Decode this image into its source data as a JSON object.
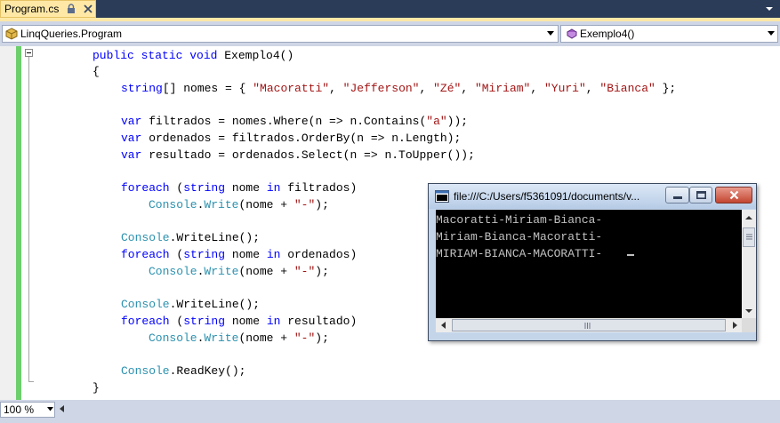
{
  "tab": {
    "title": "Program.cs",
    "pin_icon": "lock-icon",
    "close_icon": "close-icon"
  },
  "navbar": {
    "class_selector": "LinqQueries.Program",
    "member_selector": "Exemplo4()"
  },
  "code": {
    "lines": [
      [
        [
          "kw",
          "public static void "
        ],
        [
          "p",
          "Exemplo4()"
        ]
      ],
      [
        [
          "p",
          "{"
        ]
      ],
      [
        [
          "kw",
          "string"
        ],
        [
          "p",
          "[] nomes = { "
        ],
        [
          "str",
          "\"Macoratti\""
        ],
        [
          "p",
          ", "
        ],
        [
          "str",
          "\"Jefferson\""
        ],
        [
          "p",
          ", "
        ],
        [
          "str",
          "\"Zé\""
        ],
        [
          "p",
          ", "
        ],
        [
          "str",
          "\"Miriam\""
        ],
        [
          "p",
          ", "
        ],
        [
          "str",
          "\"Yuri\""
        ],
        [
          "p",
          ", "
        ],
        [
          "str",
          "\"Bianca\""
        ],
        [
          "p",
          " };"
        ]
      ],
      [],
      [
        [
          "kw",
          "var"
        ],
        [
          "p",
          " filtrados = nomes.Where(n => n.Contains("
        ],
        [
          "str",
          "\"a\""
        ],
        [
          "p",
          "));"
        ]
      ],
      [
        [
          "kw",
          "var"
        ],
        [
          "p",
          " ordenados = filtrados.OrderBy(n => n.Length);"
        ]
      ],
      [
        [
          "kw",
          "var"
        ],
        [
          "p",
          " resultado = ordenados.Select(n => n.ToUpper());"
        ]
      ],
      [],
      [
        [
          "kw",
          "foreach"
        ],
        [
          "p",
          " ("
        ],
        [
          "kw",
          "string"
        ],
        [
          "p",
          " nome "
        ],
        [
          "kw",
          "in"
        ],
        [
          "p",
          " filtrados)"
        ]
      ],
      [
        [
          "typ",
          "Console"
        ],
        [
          "p",
          "."
        ],
        [
          "typ",
          "Write"
        ],
        [
          "p",
          "(nome + "
        ],
        [
          "str",
          "\"-\""
        ],
        [
          "p",
          ");"
        ]
      ],
      [],
      [
        [
          "typ",
          "Console"
        ],
        [
          "p",
          ".WriteLine();"
        ]
      ],
      [
        [
          "kw",
          "foreach"
        ],
        [
          "p",
          " ("
        ],
        [
          "kw",
          "string"
        ],
        [
          "p",
          " nome "
        ],
        [
          "kw",
          "in"
        ],
        [
          "p",
          " ordenados)"
        ]
      ],
      [
        [
          "typ",
          "Console"
        ],
        [
          "p",
          "."
        ],
        [
          "typ",
          "Write"
        ],
        [
          "p",
          "(nome + "
        ],
        [
          "str",
          "\"-\""
        ],
        [
          "p",
          ");"
        ]
      ],
      [],
      [
        [
          "typ",
          "Console"
        ],
        [
          "p",
          ".WriteLine();"
        ]
      ],
      [
        [
          "kw",
          "foreach"
        ],
        [
          "p",
          " ("
        ],
        [
          "kw",
          "string"
        ],
        [
          "p",
          " nome "
        ],
        [
          "kw",
          "in"
        ],
        [
          "p",
          " resultado)"
        ]
      ],
      [
        [
          "typ",
          "Console"
        ],
        [
          "p",
          "."
        ],
        [
          "typ",
          "Write"
        ],
        [
          "p",
          "(nome + "
        ],
        [
          "str",
          "\"-\""
        ],
        [
          "p",
          ");"
        ]
      ],
      [],
      [
        [
          "typ",
          "Console"
        ],
        [
          "p",
          ".ReadKey();"
        ]
      ],
      [
        [
          "p",
          "}"
        ]
      ]
    ]
  },
  "console": {
    "title": "file:///C:/Users/f5361091/documents/v...",
    "output": [
      "Macoratti-Miriam-Bianca-",
      "Miriam-Bianca-Macoratti-",
      "MIRIAM-BIANCA-MACORATTI-"
    ],
    "icon": "console-app-icon"
  },
  "zoom": {
    "value": "100 %"
  },
  "colors": {
    "keyword": "#0000ff",
    "string": "#a31515",
    "type": "#2b91af",
    "tab_active": "#ffe8a6",
    "tabstrip": "#2b3c59"
  }
}
